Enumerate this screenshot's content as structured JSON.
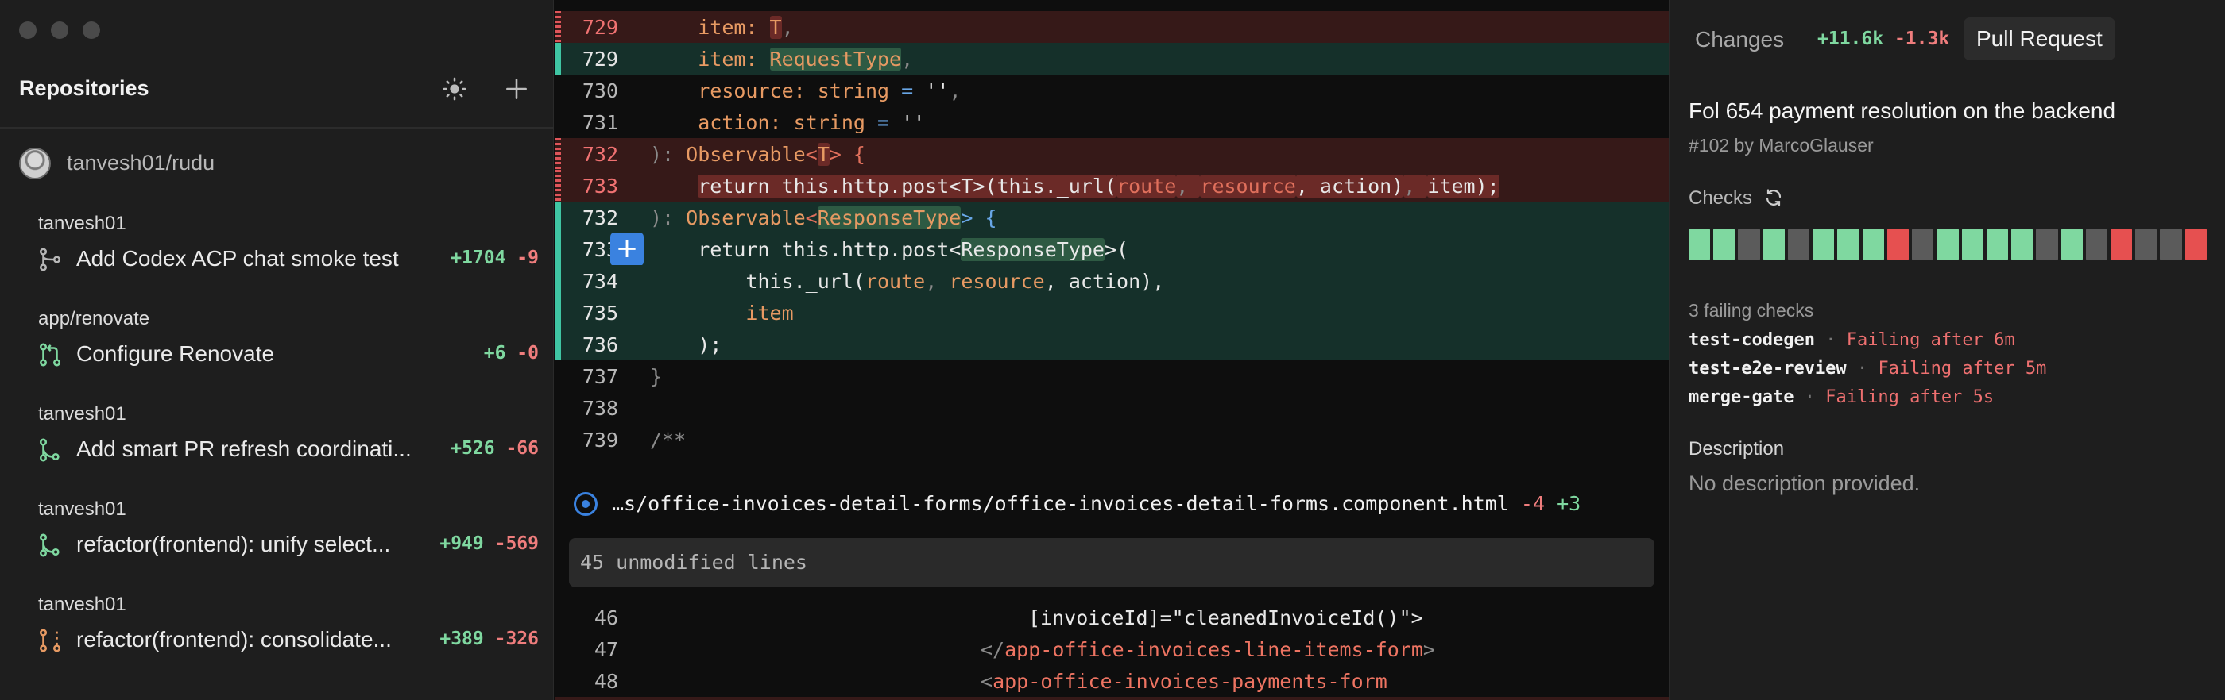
{
  "sidebar": {
    "title": "Repositories",
    "repo": "tanvesh01/rudu",
    "prs": [
      {
        "repo": "tanvesh01",
        "title": "Add Codex ACP chat smoke test",
        "add": "+1704",
        "del": "-9",
        "icon": "git-merge-icon",
        "color": "#b7b7b7"
      },
      {
        "repo": "app/renovate",
        "title": "Configure Renovate",
        "add": "+6",
        "del": "-0",
        "icon": "git-pull-request-icon",
        "color": "#7fd8a0"
      },
      {
        "repo": "tanvesh01",
        "title": "Add smart PR refresh coordinati...",
        "add": "+526",
        "del": "-66",
        "icon": "git-branch-icon",
        "color": "#7fd8a0"
      },
      {
        "repo": "tanvesh01",
        "title": "refactor(frontend): unify select...",
        "add": "+949",
        "del": "-569",
        "icon": "git-branch-icon",
        "color": "#7fd8a0"
      },
      {
        "repo": "tanvesh01",
        "title": "refactor(frontend): consolidate...",
        "add": "+389",
        "del": "-326",
        "icon": "git-pull-request-draft-icon",
        "color": "#e79a63"
      }
    ]
  },
  "code": {
    "lines": [
      {
        "num": "729",
        "type": "del"
      },
      {
        "num": "729",
        "type": "add"
      },
      {
        "num": "730",
        "type": "ctx"
      },
      {
        "num": "731",
        "type": "ctx"
      },
      {
        "num": "732",
        "type": "del"
      },
      {
        "num": "733",
        "type": "del"
      },
      {
        "num": "732",
        "type": "add"
      },
      {
        "num": "733",
        "type": "add"
      },
      {
        "num": "734",
        "type": "add"
      },
      {
        "num": "735",
        "type": "add"
      },
      {
        "num": "736",
        "type": "add"
      },
      {
        "num": "737",
        "type": "ctx"
      },
      {
        "num": "738",
        "type": "ctx"
      },
      {
        "num": "739",
        "type": "ctx"
      }
    ],
    "text": {
      "l729d_pre": "item: ",
      "l729d_t": "T",
      "l729d_post": ",",
      "l729a_pre": "item: ",
      "l729a_t": "RequestType",
      "l729a_post": ",",
      "l730_a": "resource: ",
      "l730_b": "string",
      "l730_c": " = ",
      "l730_d": "''",
      "l730_e": ",",
      "l731_a": "action: ",
      "l731_b": "string",
      "l731_c": " = ",
      "l731_d": "''",
      "l732d_a": "): ",
      "l732d_b": "Observable",
      "l732d_c": "<",
      "l732d_t": "T",
      "l732d_d": "> {",
      "l733d_a": "return this.http.post<T>(this._url(",
      "l733d_b": "route",
      "l733d_c": ", ",
      "l733d_d": "resource",
      "l733d_e": ", action)",
      "l733d_f": ", ",
      "l733d_g": "item);",
      "l732a_a": "): ",
      "l732a_b": "Observable",
      "l732a_c": "<",
      "l732a_t": "ResponseType",
      "l732a_d": "> {",
      "l733a_a": "return this.http.post<",
      "l733a_t": "ResponseType",
      "l733a_b": ">(",
      "l734_a": "this._url(",
      "l734_b": "route",
      "l734_c": ", ",
      "l734_d": "resource",
      "l734_e": ", action),",
      "l735": "item",
      "l736": ");",
      "l737": "}",
      "l739": "/**"
    },
    "file_path": "…s/office-invoices-detail-forms/office-invoices-detail-forms.component.html",
    "file_del": "-4",
    "file_add": "+3",
    "unmodified": "45 unmodified lines",
    "tail": [
      {
        "num": "46",
        "text": "[invoiceId]=\"cleanedInvoiceId()\">"
      },
      {
        "num": "47",
        "a": "</",
        "b": "app-office-invoices-line-items-form",
        "c": ">"
      },
      {
        "num": "48",
        "a": "<",
        "b": "app-office-invoices-payments-form"
      }
    ]
  },
  "panel": {
    "changes_label": "Changes",
    "changes_add": "+11.6k",
    "changes_del": "-1.3k",
    "pr_tab": "Pull Request",
    "pr_title": "Fol 654 payment resolution on the backend",
    "pr_sub": "#102 by MarcoGlauser",
    "checks_label": "Checks",
    "checks": [
      "s",
      "s",
      "p",
      "s",
      "p",
      "s",
      "s",
      "s",
      "f",
      "p",
      "s",
      "s",
      "s",
      "s",
      "p",
      "s",
      "p",
      "f",
      "p",
      "p",
      "f"
    ],
    "failing_count": "3 failing checks",
    "failing": [
      {
        "name": "test-codegen",
        "msg": "Failing after 6m"
      },
      {
        "name": "test-e2e-review",
        "msg": "Failing after 5m"
      },
      {
        "name": "merge-gate",
        "msg": "Failing after 5s"
      }
    ],
    "desc_label": "Description",
    "desc_text": "No description provided."
  },
  "colors": {
    "add": "#7fd8a0",
    "del": "#ef7d7d",
    "accent": "#3a82e0",
    "fail": "#e65050"
  }
}
